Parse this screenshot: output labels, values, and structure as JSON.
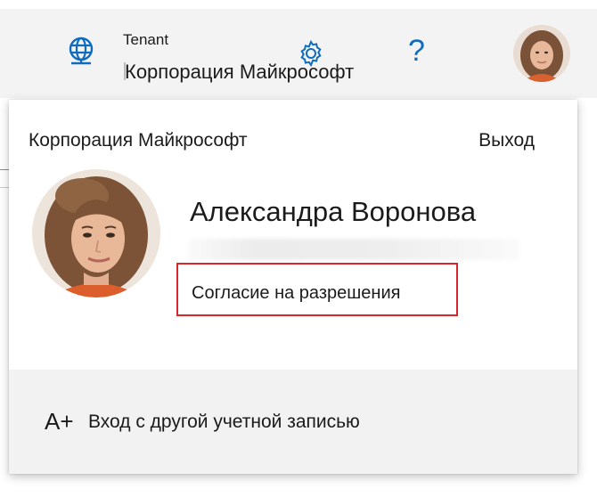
{
  "header": {
    "tenant_label": "Tenant",
    "tenant_name": "Корпорация Майкрософт",
    "help_glyph": "?",
    "icons": {
      "directory": "globe-network-icon",
      "settings": "gear-icon",
      "help": "question-mark-icon",
      "account": "avatar"
    },
    "accent_color": "#0f6cbd"
  },
  "account_card": {
    "organization": "Корпорация Майкрософт",
    "sign_out_label": "Выход",
    "user_name": "Александра Воронова",
    "consent_link_label": "Согласие на разрешения",
    "add_account_icon_glyph": "A+",
    "add_account_label": "Вход с другой учетной записью",
    "highlight_color": "#d9262d"
  }
}
